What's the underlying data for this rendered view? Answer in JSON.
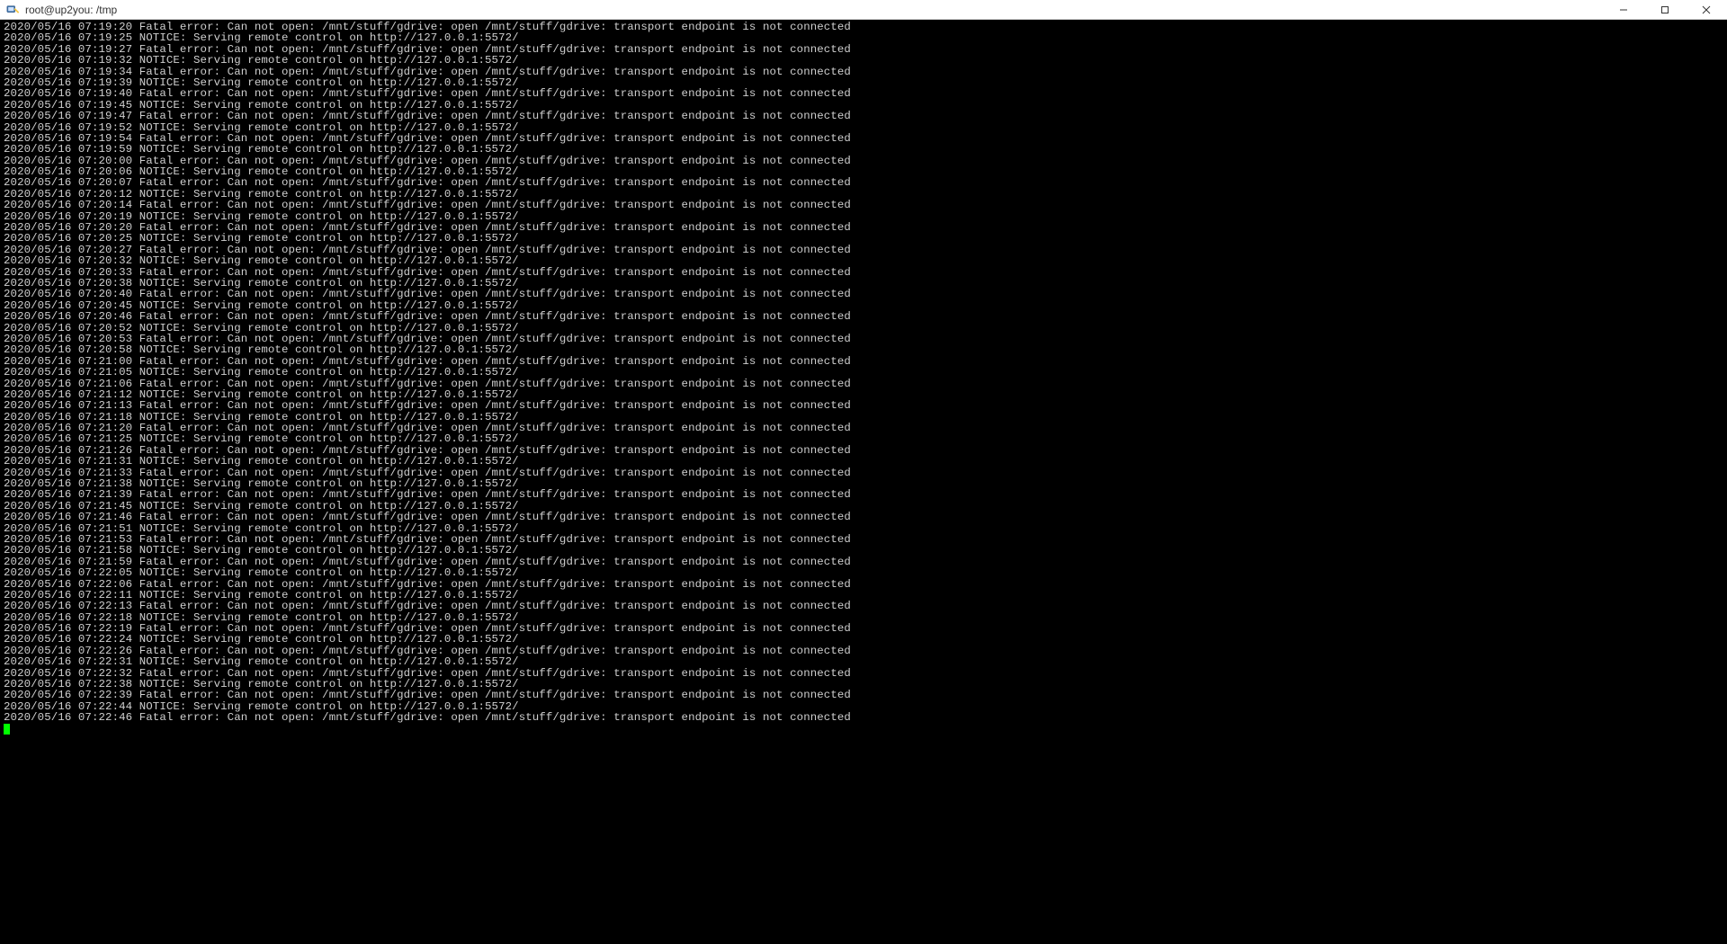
{
  "window": {
    "title": "root@up2you: /tmp"
  },
  "log": {
    "date": "2020/05/16",
    "fatal_msg": "Fatal error: Can not open: /mnt/stuff/gdrive: open /mnt/stuff/gdrive: transport endpoint is not connected",
    "notice_msg": "NOTICE: Serving remote control on http://127.0.0.1:5572/",
    "entries": [
      {
        "time": "07:19:20",
        "type": "fatal"
      },
      {
        "time": "07:19:25",
        "type": "notice"
      },
      {
        "time": "07:19:27",
        "type": "fatal"
      },
      {
        "time": "07:19:32",
        "type": "notice"
      },
      {
        "time": "07:19:34",
        "type": "fatal"
      },
      {
        "time": "07:19:39",
        "type": "notice"
      },
      {
        "time": "07:19:40",
        "type": "fatal"
      },
      {
        "time": "07:19:45",
        "type": "notice"
      },
      {
        "time": "07:19:47",
        "type": "fatal"
      },
      {
        "time": "07:19:52",
        "type": "notice"
      },
      {
        "time": "07:19:54",
        "type": "fatal"
      },
      {
        "time": "07:19:59",
        "type": "notice"
      },
      {
        "time": "07:20:00",
        "type": "fatal"
      },
      {
        "time": "07:20:06",
        "type": "notice"
      },
      {
        "time": "07:20:07",
        "type": "fatal"
      },
      {
        "time": "07:20:12",
        "type": "notice"
      },
      {
        "time": "07:20:14",
        "type": "fatal"
      },
      {
        "time": "07:20:19",
        "type": "notice"
      },
      {
        "time": "07:20:20",
        "type": "fatal"
      },
      {
        "time": "07:20:25",
        "type": "notice"
      },
      {
        "time": "07:20:27",
        "type": "fatal"
      },
      {
        "time": "07:20:32",
        "type": "notice"
      },
      {
        "time": "07:20:33",
        "type": "fatal"
      },
      {
        "time": "07:20:38",
        "type": "notice"
      },
      {
        "time": "07:20:40",
        "type": "fatal"
      },
      {
        "time": "07:20:45",
        "type": "notice"
      },
      {
        "time": "07:20:46",
        "type": "fatal"
      },
      {
        "time": "07:20:52",
        "type": "notice"
      },
      {
        "time": "07:20:53",
        "type": "fatal"
      },
      {
        "time": "07:20:58",
        "type": "notice"
      },
      {
        "time": "07:21:00",
        "type": "fatal"
      },
      {
        "time": "07:21:05",
        "type": "notice"
      },
      {
        "time": "07:21:06",
        "type": "fatal"
      },
      {
        "time": "07:21:12",
        "type": "notice"
      },
      {
        "time": "07:21:13",
        "type": "fatal"
      },
      {
        "time": "07:21:18",
        "type": "notice"
      },
      {
        "time": "07:21:20",
        "type": "fatal"
      },
      {
        "time": "07:21:25",
        "type": "notice"
      },
      {
        "time": "07:21:26",
        "type": "fatal"
      },
      {
        "time": "07:21:31",
        "type": "notice"
      },
      {
        "time": "07:21:33",
        "type": "fatal"
      },
      {
        "time": "07:21:38",
        "type": "notice"
      },
      {
        "time": "07:21:39",
        "type": "fatal"
      },
      {
        "time": "07:21:45",
        "type": "notice"
      },
      {
        "time": "07:21:46",
        "type": "fatal"
      },
      {
        "time": "07:21:51",
        "type": "notice"
      },
      {
        "time": "07:21:53",
        "type": "fatal"
      },
      {
        "time": "07:21:58",
        "type": "notice"
      },
      {
        "time": "07:21:59",
        "type": "fatal"
      },
      {
        "time": "07:22:05",
        "type": "notice"
      },
      {
        "time": "07:22:06",
        "type": "fatal"
      },
      {
        "time": "07:22:11",
        "type": "notice"
      },
      {
        "time": "07:22:13",
        "type": "fatal"
      },
      {
        "time": "07:22:18",
        "type": "notice"
      },
      {
        "time": "07:22:19",
        "type": "fatal"
      },
      {
        "time": "07:22:24",
        "type": "notice"
      },
      {
        "time": "07:22:26",
        "type": "fatal"
      },
      {
        "time": "07:22:31",
        "type": "notice"
      },
      {
        "time": "07:22:32",
        "type": "fatal"
      },
      {
        "time": "07:22:38",
        "type": "notice"
      },
      {
        "time": "07:22:39",
        "type": "fatal"
      },
      {
        "time": "07:22:44",
        "type": "notice"
      },
      {
        "time": "07:22:46",
        "type": "fatal"
      }
    ]
  }
}
